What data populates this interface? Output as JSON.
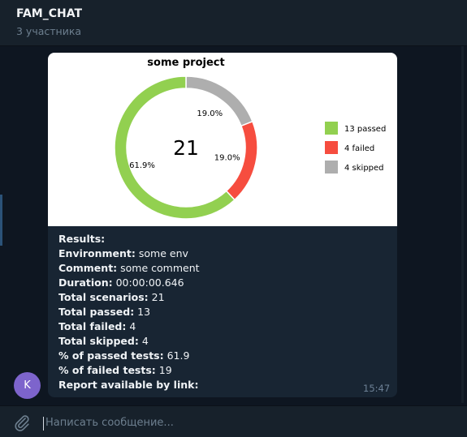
{
  "header": {
    "title": "FAM_CHAT",
    "subtitle": "3 участника"
  },
  "message": {
    "sender_initial": "K",
    "time": "15:47",
    "lines": [
      {
        "label": "Results:",
        "value": ""
      },
      {
        "label": "Environment:",
        "value": " some env"
      },
      {
        "label": "Comment:",
        "value": " some comment"
      },
      {
        "label": "Duration:",
        "value": " 00:00:00.646"
      },
      {
        "label": "Total scenarios:",
        "value": " 21"
      },
      {
        "label": "Total passed:",
        "value": " 13"
      },
      {
        "label": "Total failed:",
        "value": " 4"
      },
      {
        "label": "Total skipped:",
        "value": " 4"
      },
      {
        "label": "% of passed tests:",
        "value": " 61.9"
      },
      {
        "label": "% of failed tests:",
        "value": " 19"
      },
      {
        "label": "Report available by link:",
        "value": ""
      }
    ]
  },
  "chart_data": {
    "type": "pie",
    "title": "some project",
    "center_label": "21",
    "slices": [
      {
        "name": "13 passed",
        "value": 13,
        "percent_label": "61.9%",
        "color": "#92d050"
      },
      {
        "name": "4 failed",
        "value": 4,
        "percent_label": "19.0%",
        "color": "#f64d3f"
      },
      {
        "name": "4 skipped",
        "value": 4,
        "percent_label": "19.0%",
        "color": "#aeaeae"
      }
    ],
    "legend_position": "right"
  },
  "input": {
    "placeholder": "Написать сообщение..."
  },
  "icons": {
    "attach": "paperclip-icon"
  },
  "colors": {
    "background": "#0e1621",
    "header": "#17212b",
    "bubble": "#182533",
    "avatar": "#7d64cc",
    "passed": "#92d050",
    "failed": "#f64d3f",
    "skipped": "#aeaeae"
  }
}
